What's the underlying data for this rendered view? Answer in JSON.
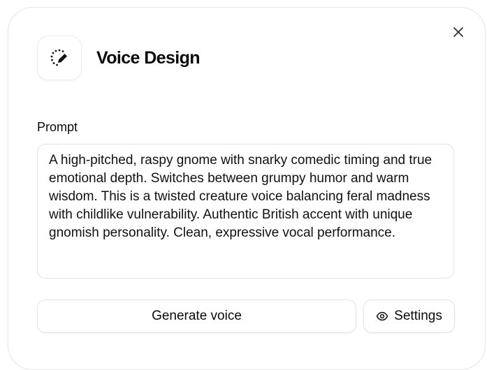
{
  "dialog": {
    "title": "Voice Design",
    "close_icon": "close-icon",
    "logo_icon": "voice-design-icon"
  },
  "prompt": {
    "label": "Prompt",
    "value": "A high-pitched, raspy gnome with snarky comedic timing and true emotional depth. Switches between grumpy humor and warm wisdom. This is a twisted creature voice balancing feral madness with childlike vulnerability. Authentic British accent with unique gnomish personality. Clean, expressive vocal performance."
  },
  "actions": {
    "generate_label": "Generate voice",
    "settings_label": "Settings",
    "settings_icon": "eye-icon"
  }
}
